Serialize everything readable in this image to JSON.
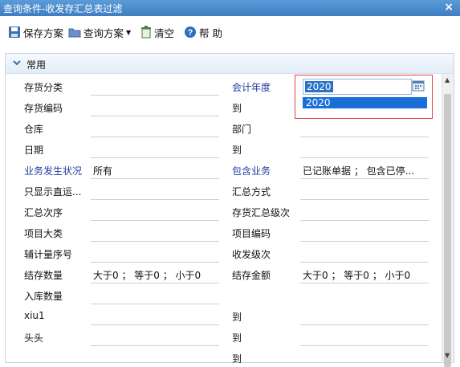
{
  "window": {
    "title": "查询条件-收发存汇总表过滤",
    "close_label": "×"
  },
  "toolbar": {
    "save_label": "保存方案",
    "query_label": "查询方案",
    "clear_label": "清空",
    "help_label": "帮 助"
  },
  "section": {
    "label": "常用"
  },
  "fields": {
    "l1": "存货分类",
    "l2": "存货编码",
    "l3": "仓库",
    "l4": "日期",
    "l5": "业务发生状况",
    "l5v": "所有",
    "l6": "只显示直运...",
    "l7": "汇总次序",
    "l8": "项目大类",
    "l9": "辅计量序号",
    "l10": "结存数量",
    "l10v": "大于0 ； 等于0 ； 小于0",
    "l11": "入库数量",
    "l12": "xiu1",
    "l13": "头头",
    "l14": "",
    "r1": "会计年度",
    "r2": "到",
    "r3": "部门",
    "r4": "到",
    "r5": "包含业务",
    "r5v": "已记账单据 ； 包含已停...",
    "r6": "汇总方式",
    "r7": "存货汇总级次",
    "r8": "项目编码",
    "r9": "收发级次",
    "r10": "结存金额",
    "r10v": "大于0 ； 等于0 ； 小于0",
    "r12": "到",
    "r13": "到",
    "r14": "到"
  },
  "year": {
    "value": "2020",
    "option": "2020"
  },
  "colors": {
    "title_bar": "#3f7fc2",
    "link_label": "#1f3c9e",
    "highlight": "#e0434a",
    "selection": "#1a6ed8"
  }
}
